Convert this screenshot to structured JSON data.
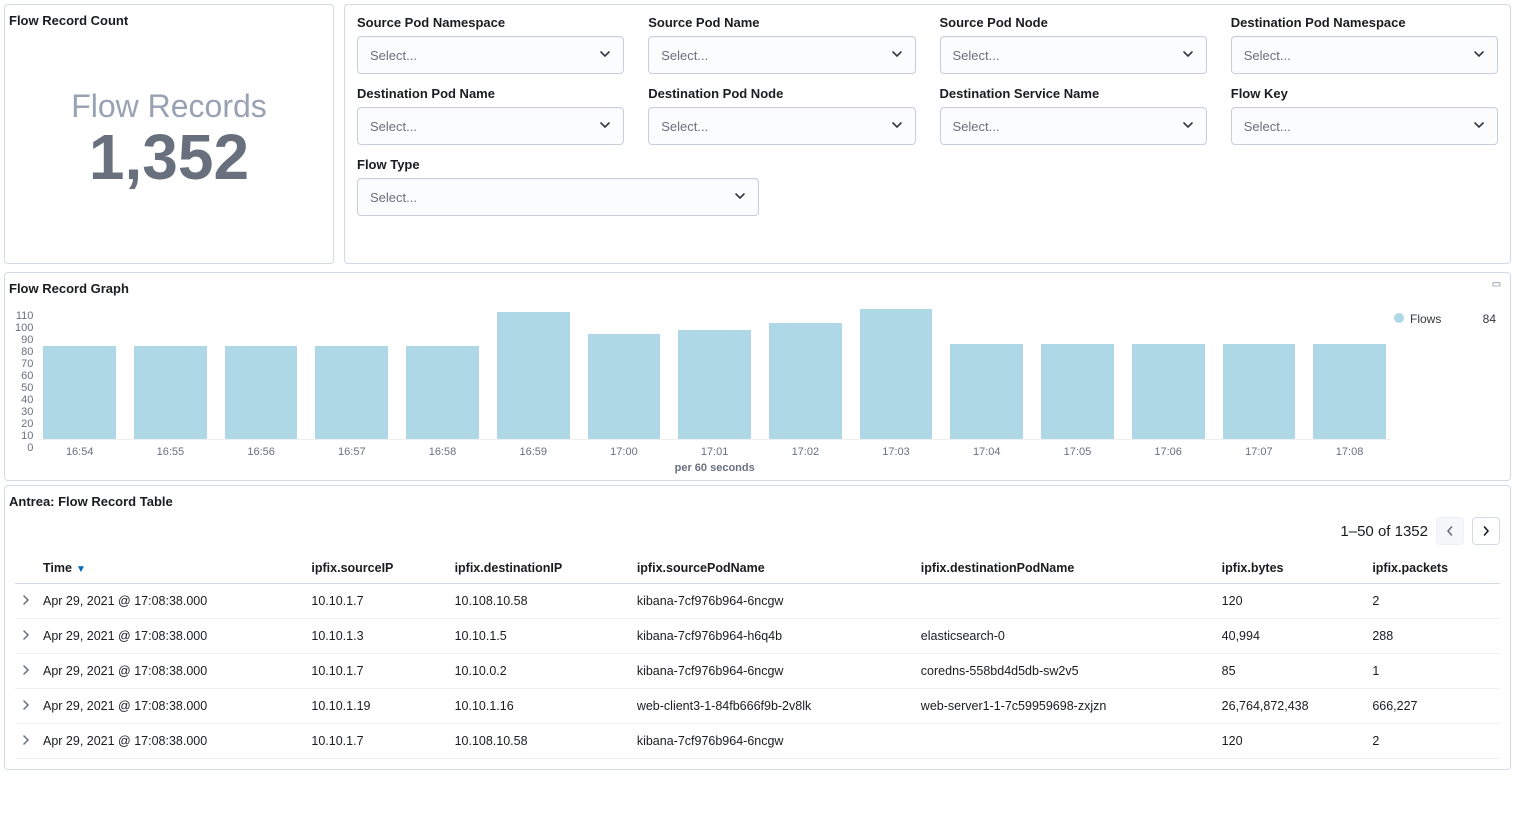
{
  "countPanel": {
    "title": "Flow Record Count",
    "label": "Flow Records",
    "value": "1,352"
  },
  "filters": {
    "placeholder": "Select...",
    "items": [
      {
        "label": "Source Pod Namespace"
      },
      {
        "label": "Source Pod Name"
      },
      {
        "label": "Source Pod Node"
      },
      {
        "label": "Destination Pod Namespace"
      },
      {
        "label": "Destination Pod Name"
      },
      {
        "label": "Destination Pod Node"
      },
      {
        "label": "Destination Service Name"
      },
      {
        "label": "Flow Key"
      }
    ],
    "flowType": {
      "label": "Flow Type"
    }
  },
  "graph": {
    "title": "Flow Record Graph",
    "xTitle": "per 60 seconds",
    "legend": {
      "name": "Flows",
      "value": "84"
    }
  },
  "chart_data": {
    "type": "bar",
    "categories": [
      "16:54",
      "16:55",
      "16:56",
      "16:57",
      "16:58",
      "16:59",
      "17:00",
      "17:01",
      "17:02",
      "17:03",
      "17:04",
      "17:05",
      "17:06",
      "17:07",
      "17:08"
    ],
    "values": [
      82,
      82,
      82,
      82,
      82,
      112,
      93,
      96,
      103,
      115,
      84,
      84,
      84,
      84,
      84
    ],
    "title": "Flow Record Graph",
    "xlabel": "per 60 seconds",
    "ylabel": "",
    "ylim": [
      0,
      115
    ],
    "yticks": [
      0,
      10,
      20,
      30,
      40,
      50,
      60,
      70,
      80,
      90,
      100,
      110
    ],
    "series_name": "Flows"
  },
  "table": {
    "title": "Antrea: Flow Record Table",
    "pageInfo": "1–50 of 1352",
    "columns": [
      "Time",
      "ipfix.sourceIP",
      "ipfix.destinationIP",
      "ipfix.sourcePodName",
      "ipfix.destinationPodName",
      "ipfix.bytes",
      "ipfix.packets"
    ],
    "rows": [
      {
        "time": "Apr 29, 2021 @ 17:08:38.000",
        "srcIP": "10.10.1.7",
        "dstIP": "10.108.10.58",
        "srcPod": "kibana-7cf976b964-6ncgw",
        "dstPod": "",
        "bytes": "120",
        "packets": "2"
      },
      {
        "time": "Apr 29, 2021 @ 17:08:38.000",
        "srcIP": "10.10.1.3",
        "dstIP": "10.10.1.5",
        "srcPod": "kibana-7cf976b964-h6q4b",
        "dstPod": "elasticsearch-0",
        "bytes": "40,994",
        "packets": "288"
      },
      {
        "time": "Apr 29, 2021 @ 17:08:38.000",
        "srcIP": "10.10.1.7",
        "dstIP": "10.10.0.2",
        "srcPod": "kibana-7cf976b964-6ncgw",
        "dstPod": "coredns-558bd4d5db-sw2v5",
        "bytes": "85",
        "packets": "1"
      },
      {
        "time": "Apr 29, 2021 @ 17:08:38.000",
        "srcIP": "10.10.1.19",
        "dstIP": "10.10.1.16",
        "srcPod": "web-client3-1-84fb666f9b-2v8lk",
        "dstPod": "web-server1-1-7c59959698-zxjzn",
        "bytes": "26,764,872,438",
        "packets": "666,227"
      },
      {
        "time": "Apr 29, 2021 @ 17:08:38.000",
        "srcIP": "10.10.1.7",
        "dstIP": "10.108.10.58",
        "srcPod": "kibana-7cf976b964-6ncgw",
        "dstPod": "",
        "bytes": "120",
        "packets": "2"
      }
    ]
  }
}
